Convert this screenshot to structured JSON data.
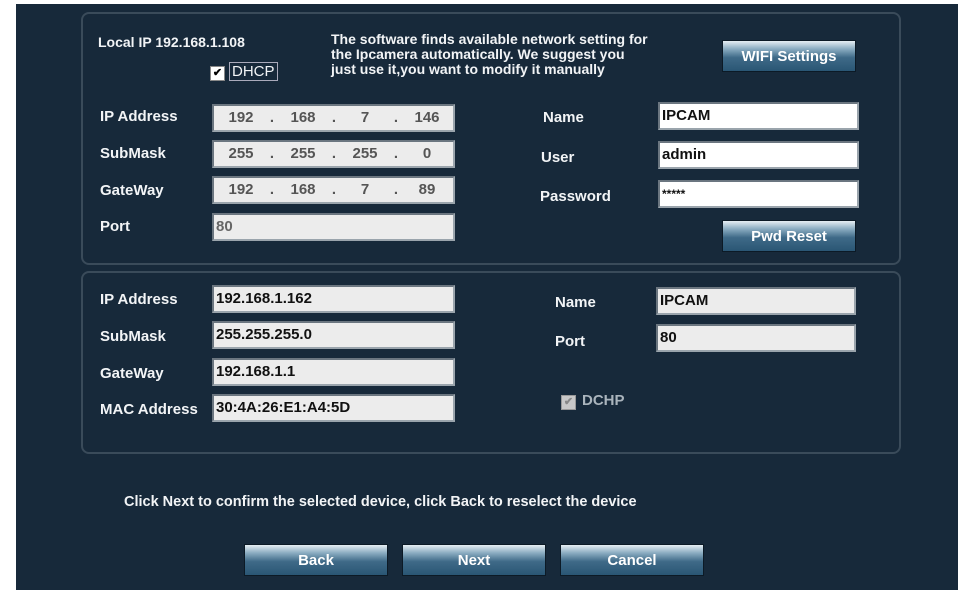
{
  "top": {
    "local_ip": "Local IP 192.168.1.108",
    "dhcp_label": "DHCP",
    "dhcp_checked": true,
    "info_lines": [
      "The software finds available network setting for",
      "the Ipcamera automatically. We suggest you",
      "just use it,you want to modify it manually"
    ],
    "wifi_button": "WIFI Settings",
    "labels": {
      "ip": "IP Address",
      "submask": "SubMask",
      "gateway": "GateWay",
      "port": "Port",
      "name": "Name",
      "user": "User",
      "password": "Password"
    },
    "ip": [
      "192",
      "168",
      "7",
      "146"
    ],
    "submask": [
      "255",
      "255",
      "255",
      "0"
    ],
    "gateway": [
      "192",
      "168",
      "7",
      "89"
    ],
    "port": "80",
    "name": "IPCAM",
    "user": "admin",
    "password": "*****",
    "pwd_reset_button": "Pwd Reset"
  },
  "bottom": {
    "labels": {
      "ip": "IP Address",
      "submask": "SubMask",
      "gateway": "GateWay",
      "mac": "MAC Address",
      "name": "Name",
      "port": "Port"
    },
    "ip": "192.168.1.162",
    "submask": "255.255.255.0",
    "gateway": "192.168.1.1",
    "mac": "30:4A:26:E1:A4:5D",
    "name": "IPCAM",
    "port": "80",
    "dchp_label": "DCHP",
    "dchp_checked": true
  },
  "instruction": "Click Next to confirm the selected device, click Back to reselect the device",
  "buttons": {
    "back": "Back",
    "next": "Next",
    "cancel": "Cancel"
  }
}
